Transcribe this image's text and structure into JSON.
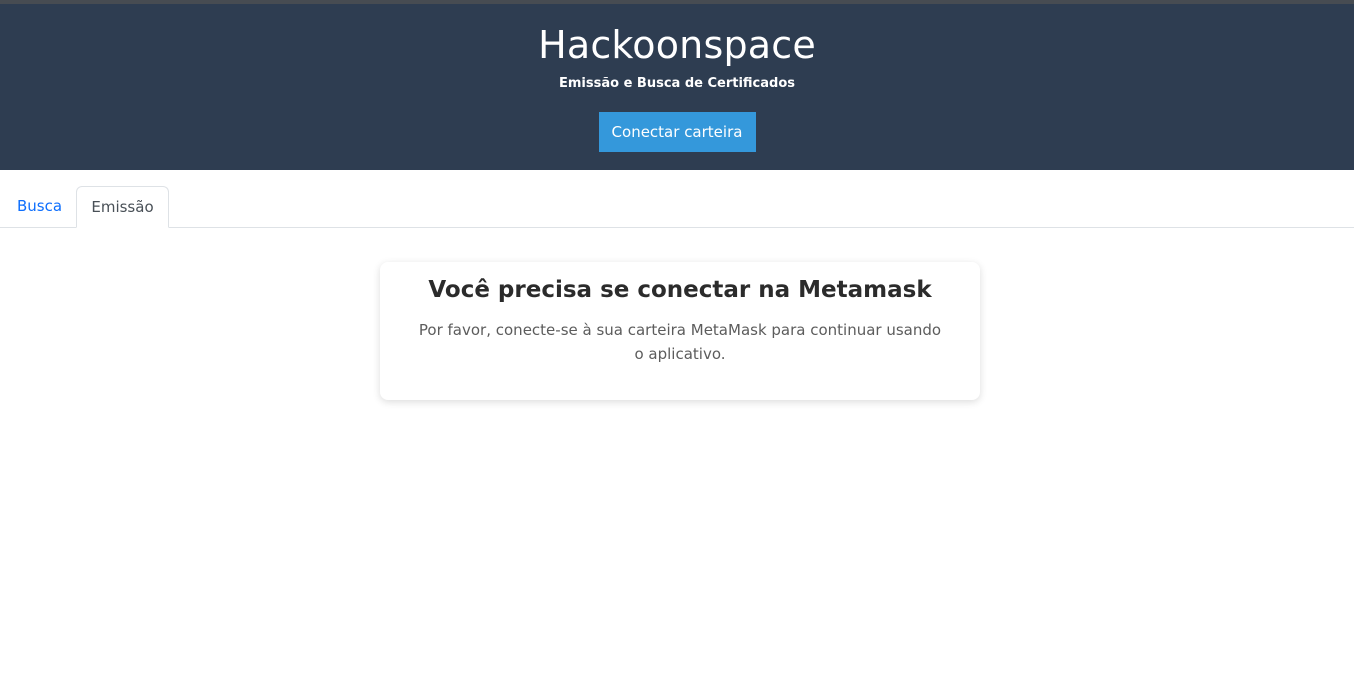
{
  "header": {
    "title": "Hackoonspace",
    "subtitle": "Emissão e Busca de Certificados",
    "connect_label": "Conectar carteira"
  },
  "tabs": [
    {
      "label": "Busca",
      "active": false
    },
    {
      "label": "Emissão",
      "active": true
    }
  ],
  "notice": {
    "title": "Você precisa se conectar na Metamask",
    "message": "Por favor, conecte-se à sua carteira MetaMask para continuar usando o aplicativo."
  },
  "colors": {
    "header_bg": "#2e3d51",
    "accent": "#3498db",
    "link": "#0d6efd"
  }
}
